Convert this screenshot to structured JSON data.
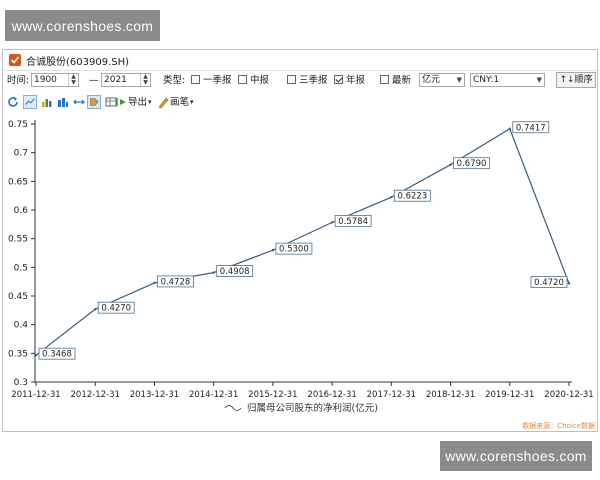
{
  "watermark_top": "www.corenshoes.com",
  "watermark_bottom": "www.corenshoes.com",
  "window": {
    "title": "合诚股份(603909.SH)"
  },
  "controls": {
    "time_label": "时间:",
    "start_year": "1900",
    "dash": "—",
    "end_year": "2021",
    "type_label": "类型:",
    "periods": [
      {
        "label": "一季报",
        "checked": false
      },
      {
        "label": "中报",
        "checked": false
      },
      {
        "label": "三季报",
        "checked": false
      },
      {
        "label": "年报",
        "checked": true
      },
      {
        "label": "最新",
        "checked": false
      }
    ],
    "unit_select": "亿元",
    "currency_select": "CNY:1",
    "order_button": "↑↓顺序"
  },
  "toolbar": {
    "icons": [
      "refresh-icon",
      "line-chart-icon",
      "bar-chart-icon",
      "column-chart-icon",
      "link-icon",
      "tag-icon",
      "table-icon"
    ],
    "export_label": "导出",
    "brush_label": "画笔"
  },
  "colors": {
    "line": "#3a5b7a",
    "label_border": "#4a6f8f",
    "source_text": "#e8883a",
    "accent_icon": "#d9541e"
  },
  "chart_data": {
    "type": "line",
    "categories": [
      "2011-12-31",
      "2012-12-31",
      "2013-12-31",
      "2014-12-31",
      "2015-12-31",
      "2016-12-31",
      "2017-12-31",
      "2018-12-31",
      "2019-12-31",
      "2020-12-31"
    ],
    "series": [
      {
        "name": "归属母公司股东的净利润(亿元)",
        "values": [
          0.3468,
          0.427,
          0.4728,
          0.4908,
          0.53,
          0.5784,
          0.6223,
          0.679,
          0.7417,
          0.472
        ],
        "labels": [
          "0.3468",
          "0.4270",
          "0.4728",
          "0.4908",
          "0.5300",
          "0.5784",
          "0.6223",
          "0.6790",
          "0.7417",
          "0.4720"
        ]
      }
    ],
    "yticks": [
      "0.75",
      "0.7",
      "0.65",
      "0.6",
      "0.55",
      "0.5",
      "0.45",
      "0.4",
      "0.35",
      "0.3"
    ],
    "ylim": [
      0.3,
      0.75
    ],
    "source": "数据来源：Choice数据"
  }
}
